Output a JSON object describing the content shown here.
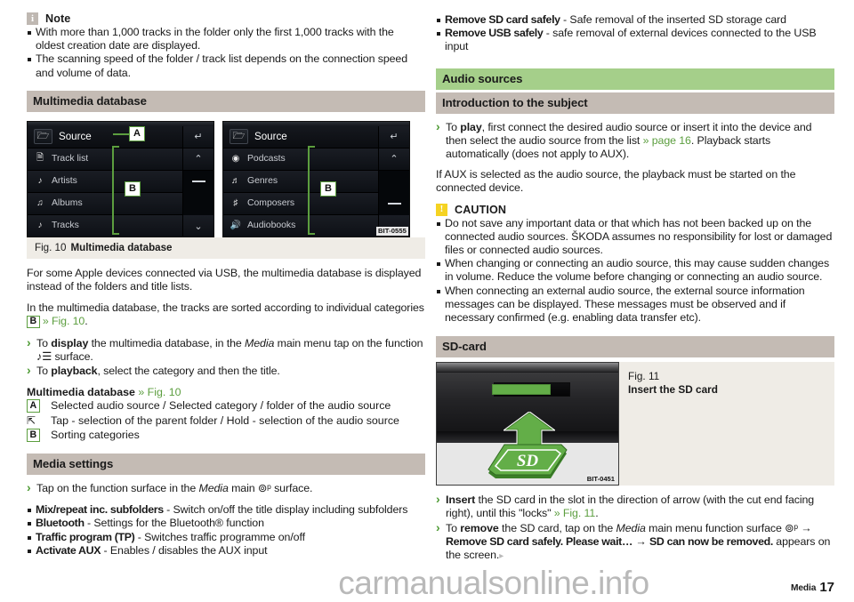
{
  "left": {
    "note": {
      "icon": "info-icon",
      "label": "Note",
      "bullets": [
        "With more than 1,000 tracks in the folder only the first 1,000 tracks with the oldest creation date are displayed.",
        "The scanning speed of the folder / track list depends on the connection speed and volume of data."
      ]
    },
    "heading_multimedia_database": "Multimedia database",
    "figure10": {
      "caption_number": "Fig. 10",
      "caption_title": "Multimedia database",
      "image_code": "BIT-0555",
      "screen_left": {
        "header": "Source",
        "header_icon": "folder-up-icon",
        "items": [
          {
            "label": "Track list",
            "icon": "tracklist-icon"
          },
          {
            "label": "Artists",
            "icon": "artist-icon"
          },
          {
            "label": "Albums",
            "icon": "album-icon"
          },
          {
            "label": "Tracks",
            "icon": "note-icon"
          }
        ],
        "side_buttons": [
          "back-icon",
          "chevron-up-icon",
          "dash-icon",
          "chevron-down-icon"
        ]
      },
      "screen_right": {
        "header": "Source",
        "header_icon": "folder-up-icon",
        "items": [
          {
            "label": "Podcasts",
            "icon": "podcast-icon"
          },
          {
            "label": "Genres",
            "icon": "genre-icon"
          },
          {
            "label": "Composers",
            "icon": "composer-icon"
          },
          {
            "label": "Audiobooks",
            "icon": "audiobook-icon"
          }
        ],
        "side_buttons": [
          "back-icon",
          "chevron-up-icon",
          "dash-icon",
          "chevron-down-icon"
        ]
      },
      "callouts": [
        "A",
        "B"
      ]
    },
    "para_apple": "For some Apple devices connected via USB, the multimedia database is displayed instead of the folders and title lists.",
    "para_sorted_pre": "In the multimedia database, the tracks are sorted according to individual categories ",
    "para_sorted_ref": "B",
    "para_sorted_xref": "» Fig. 10",
    "para_sorted_post": ".",
    "steps": [
      {
        "pre": "To ",
        "bold": "display",
        "mid": " the multimedia database, in the ",
        "italic": "Media",
        "post": " main menu tap on the function ♪☰ surface."
      },
      {
        "pre": "To ",
        "bold": "playback",
        "mid": ", select the category and then the title.",
        "italic": "",
        "post": ""
      }
    ],
    "legend_title": "Multimedia database",
    "legend_xref": "» Fig. 10",
    "legend_rows": [
      {
        "key": "A",
        "key_type": "box",
        "text": "Selected audio source / Selected category / folder of the audio source"
      },
      {
        "key": "⇱",
        "key_type": "glyph",
        "text": "Tap - selection of the parent folder / Hold - selection of the audio source"
      },
      {
        "key": "B",
        "key_type": "box",
        "text": "Sorting categories"
      }
    ],
    "heading_media_settings": "Media settings",
    "media_settings_step": {
      "pre": "Tap on the function surface in the ",
      "italic": "Media",
      "post": " main ⊚ᵖ surface."
    },
    "media_settings_items": [
      {
        "term": "Mix/repeat inc. subfolders",
        "desc": " - Switch on/off the title display including subfolders"
      },
      {
        "term": "Bluetooth",
        "desc": " - Settings for the Bluetooth® function"
      },
      {
        "term": "Traffic program (TP)",
        "desc": " - Switches traffic programme on/off"
      },
      {
        "term": "Activate AUX",
        "desc": " - Enables / disables the AUX input"
      }
    ]
  },
  "right": {
    "top_items": [
      {
        "term": "Remove SD card safely",
        "desc": " - Safe removal of the inserted SD storage card"
      },
      {
        "term": "Remove USB safely",
        "desc": " - safe removal of external devices connected to the USB input"
      }
    ],
    "heading_audio_sources": "Audio sources",
    "heading_introduction": "Introduction to the subject",
    "play_step": {
      "pre": "To ",
      "bold": "play",
      "mid": ", first connect the desired audio source or insert it into the device and then select the audio source from the list ",
      "xref": "» page 16",
      "post": ". Playback starts automatically (does not apply to AUX)."
    },
    "para_aux": "If AUX is selected as the audio source, the playback must be started on the connected device.",
    "caution": {
      "icon": "warning-icon",
      "label": "CAUTION",
      "bullets": [
        "Do not save any important data or that which has not been backed up on the connected audio sources. ŠKODA assumes no responsibility for lost or damaged files or connected audio sources.",
        "When changing or connecting an audio source, this may cause sudden changes in volume. Reduce the volume before changing or connecting an audio source.",
        "When connecting an external audio source, the external source information messages can be displayed. These messages must be observed and if necessary confirmed (e.g. enabling data transfer etc)."
      ]
    },
    "heading_sd_card": "SD-card",
    "figure11": {
      "caption_number": "Fig. 11",
      "caption_title": "Insert the SD card",
      "image_code": "BIT-0451",
      "card_label": "SD"
    },
    "sd_steps": [
      {
        "bold": "Insert",
        "mid": " the SD card in the slot in the direction of arrow (with the cut end facing right), until this \"locks\" ",
        "xref": "» Fig. 11",
        "post": "."
      }
    ],
    "sd_remove": {
      "pre": "To ",
      "bold": "remove",
      "mid": " the SD card, tap on the ",
      "italic": "Media",
      "mid2": " main menu function surface ⊚ᵖ → ",
      "cond1": "Remove SD card safely",
      "cond1b": ". Please wait…",
      "arrow": " → ",
      "cond2": "SD can now be removed.",
      "post": " appears on the screen."
    }
  },
  "footer": {
    "dots": "",
    "chapter": "Media",
    "page_number": "17"
  },
  "watermark": "carmanualsonline.info",
  "colors": {
    "heading_green": "#a5cf8a",
    "heading_grey": "#c4bbb4",
    "xref_green": "#5c9e3f",
    "figure_caption_bg": "#efece6",
    "caution_yellow": "#f5d322",
    "note_grey": "#bfb8b2"
  }
}
